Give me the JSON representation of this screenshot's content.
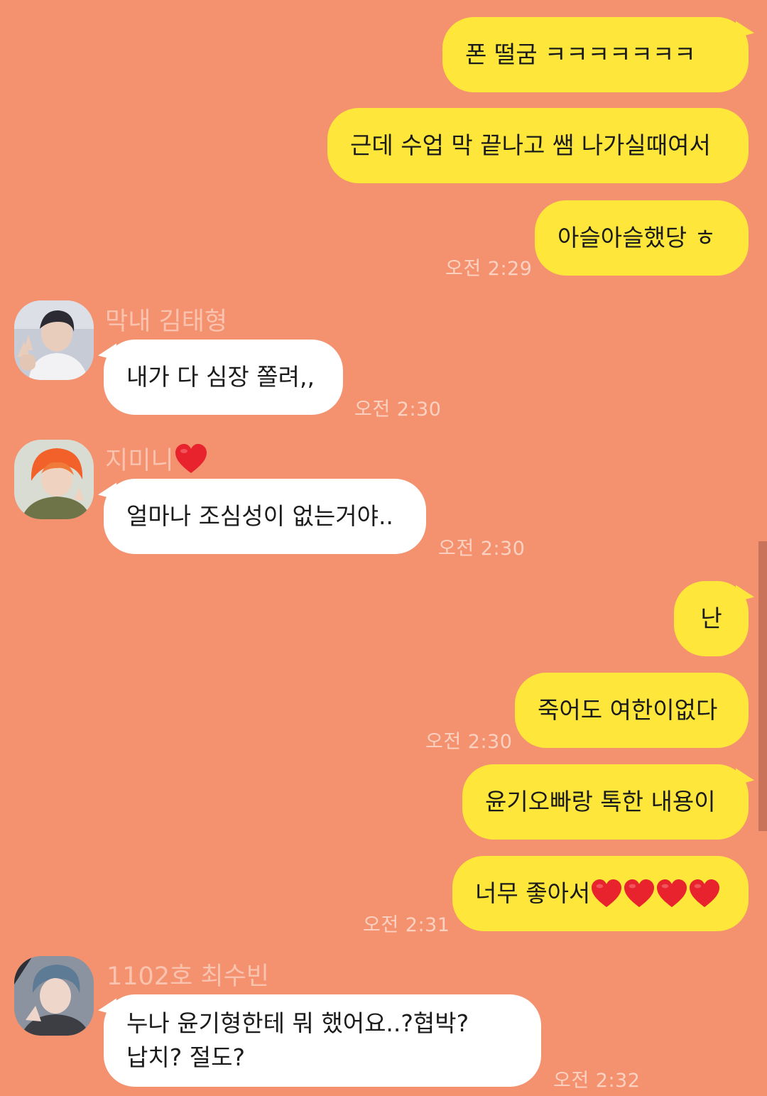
{
  "messages_mine_1": [
    {
      "text": "폰 떨굼 ㅋㅋㅋㅋㅋㅋㅋ"
    },
    {
      "text": "근데 수업 막 끝나고 쌤 나가실때여서"
    },
    {
      "text": "아슬아슬했당 ㅎ"
    }
  ],
  "time_mine_1": "오전 2:29",
  "contact_1": {
    "name": "막내 김태형",
    "message": "내가 다 심장 쫄려,,",
    "time": "오전 2:30"
  },
  "contact_2": {
    "name": "지미니",
    "message": "얼마나 조심성이 없는거야..",
    "time": "오전 2:30"
  },
  "messages_mine_2": [
    {
      "text": "난"
    },
    {
      "text": "죽어도 여한이없다"
    }
  ],
  "time_mine_2": "오전 2:30",
  "messages_mine_3": [
    {
      "text": "윤기오빠랑 톡한 내용이"
    },
    {
      "text": "너무 좋아서"
    }
  ],
  "time_mine_3": "오전 2:31",
  "contact_3": {
    "name": "1102호 최수빈",
    "message": "누나 윤기형한테 뭐 했어요..?협박? 납치? 절도?",
    "time": "오전 2:32"
  },
  "colors": {
    "background": "#F4916F",
    "my_bubble": "#FEE73A",
    "their_bubble": "#FFFFFF",
    "heart": "#E8232E"
  }
}
